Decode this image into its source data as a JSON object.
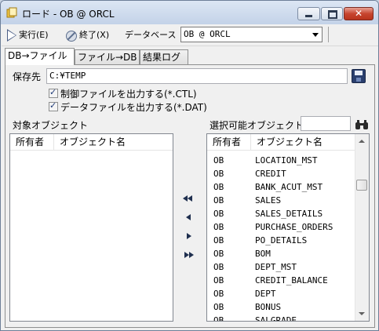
{
  "window": {
    "title": "ロード - OB @ ORCL"
  },
  "toolbar": {
    "run_label": "実行(E)",
    "exit_label": "終了(X)",
    "database_label": "データベース",
    "database_value": "OB @ ORCL"
  },
  "tabs": [
    {
      "label": "DB→ファイル",
      "active": true
    },
    {
      "label": "ファイル→DB",
      "active": false
    },
    {
      "label": "結果ログ",
      "active": false
    }
  ],
  "save_dest": {
    "label": "保存先",
    "value": "C:¥TEMP"
  },
  "options": {
    "ctl_label": "制御ファイルを出力する(*.CTL)",
    "ctl_checked": true,
    "dat_label": "データファイルを出力する(*.DAT)",
    "dat_checked": true
  },
  "target_objects": {
    "label": "対象オブジェクト",
    "col_owner": "所有者",
    "col_name": "オブジェクト名",
    "rows": []
  },
  "selectable_objects": {
    "label": "選択可能オブジェクト",
    "filter_value": "",
    "col_owner": "所有者",
    "col_name": "オブジェクト名",
    "rows": [
      {
        "owner": "OB",
        "name": "LOCATION_MST"
      },
      {
        "owner": "OB",
        "name": "CREDIT"
      },
      {
        "owner": "OB",
        "name": "BANK_ACUT_MST"
      },
      {
        "owner": "OB",
        "name": "SALES"
      },
      {
        "owner": "OB",
        "name": "SALES_DETAILS"
      },
      {
        "owner": "OB",
        "name": "PURCHASE_ORDERS"
      },
      {
        "owner": "OB",
        "name": "PO_DETAILS"
      },
      {
        "owner": "OB",
        "name": "BOM"
      },
      {
        "owner": "OB",
        "name": "DEPT_MST"
      },
      {
        "owner": "OB",
        "name": "CREDIT_BALANCE"
      },
      {
        "owner": "OB",
        "name": "DEPT"
      },
      {
        "owner": "OB",
        "name": "BONUS"
      },
      {
        "owner": "OB",
        "name": "SALGRADE"
      }
    ]
  },
  "colors": {
    "titlebar": "#c3d2e8",
    "close": "#c7452f",
    "icon_dark": "#1f2f4f"
  }
}
